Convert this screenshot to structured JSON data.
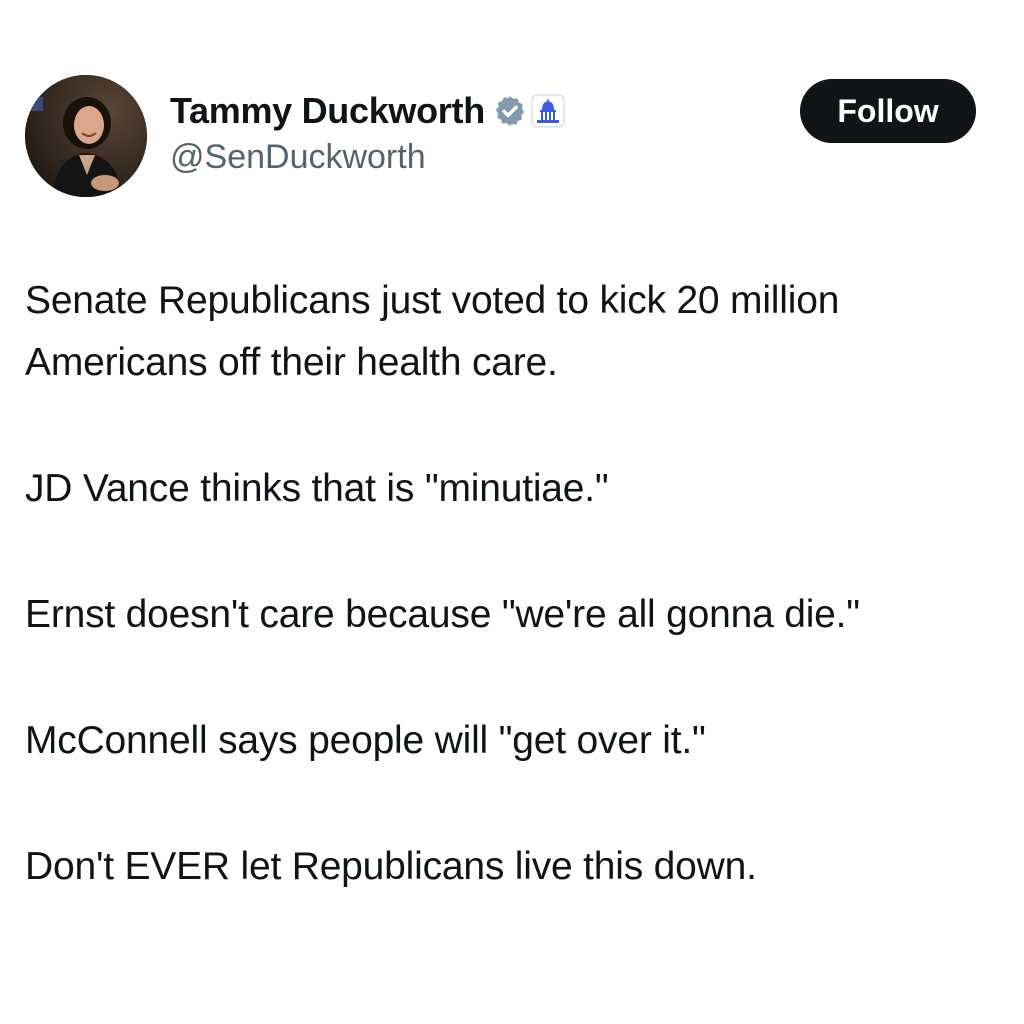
{
  "post": {
    "author": {
      "display_name": "Tammy Duckworth",
      "handle": "@SenDuckworth",
      "verified_badge_icon": "verified-badge-icon",
      "affiliate_badge_icon": "capitol-building-icon",
      "verified_color": "#829aab",
      "affiliate_color": "#3b5bdb"
    },
    "follow_label": "Follow",
    "paragraphs": [
      "Senate Republicans just voted to kick 20 million Americans off their health care.",
      "JD Vance thinks that is \"minutiae.\"",
      "Ernst doesn't care because \"we're all gonna die.\"",
      "McConnell says people will \"get over it.\"",
      "Don't EVER let Republicans live this down."
    ]
  }
}
